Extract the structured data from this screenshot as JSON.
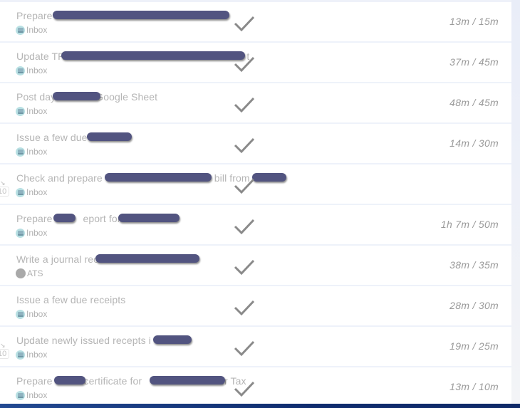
{
  "tasks": [
    {
      "title": "Prepare",
      "project": "Inbox",
      "project_icon": "inbox-icon",
      "time": "13m / 15m",
      "has_subtasks": false,
      "redactions": [
        [
          74,
          322
        ]
      ]
    },
    {
      "title": "Update TR",
      "title_tail": "t",
      "project": "Inbox",
      "project_icon": "inbox-icon",
      "time": "37m / 45m",
      "has_subtasks": false,
      "redactions": [
        [
          86,
          344
        ]
      ]
    },
    {
      "title": "Post day",
      "title_tail": "Google Sheet",
      "project": "Inbox",
      "project_icon": "inbox-icon",
      "time": "48m / 45m",
      "has_subtasks": false,
      "redactions": [
        [
          74,
          141
        ]
      ]
    },
    {
      "title": "Issue a few due",
      "project": "Inbox",
      "project_icon": "inbox-icon",
      "time": "14m / 30m",
      "has_subtasks": false,
      "redactions": [
        [
          122,
          185
        ]
      ]
    },
    {
      "title": "Check and prepare",
      "title_mid": "bill from",
      "project": "Inbox",
      "project_icon": "inbox-icon",
      "time": "",
      "has_subtasks": true,
      "subtask_count": "10",
      "redactions": [
        [
          147,
          297
        ],
        [
          354,
          402
        ]
      ]
    },
    {
      "title": "Prepare",
      "title_mid": "eport for",
      "project": "Inbox",
      "project_icon": "inbox-icon",
      "time": "1h 7m / 50m",
      "has_subtasks": false,
      "redactions": [
        [
          75,
          106
        ],
        [
          166,
          252
        ]
      ]
    },
    {
      "title": "Write a journal rec",
      "project": "ATS",
      "project_icon": "circle-icon",
      "time": "38m / 35m",
      "has_subtasks": false,
      "redactions": [
        [
          134,
          280
        ]
      ]
    },
    {
      "title": "Issue a few due receipts",
      "project": "Inbox",
      "project_icon": "inbox-icon",
      "time": "28m / 30m",
      "has_subtasks": false,
      "redactions": []
    },
    {
      "title": "Update newly issued recepts i",
      "project": "Inbox",
      "project_icon": "inbox-icon",
      "time": "19m / 25m",
      "has_subtasks": true,
      "subtask_count": "10",
      "redactions": [
        [
          215,
          269
        ]
      ]
    },
    {
      "title": "Prepare",
      "title_mid": "certificate for",
      "title_tail": "or Tax",
      "project": "Inbox",
      "project_icon": "inbox-icon",
      "time": "13m / 10m",
      "has_subtasks": false,
      "redactions": [
        [
          76,
          120
        ],
        [
          210,
          316
        ]
      ]
    }
  ],
  "colors": {
    "redaction": "#525480",
    "title_text": "#b5b5b5",
    "time_text": "#9a9a9a",
    "check": "#8a8a8a"
  }
}
